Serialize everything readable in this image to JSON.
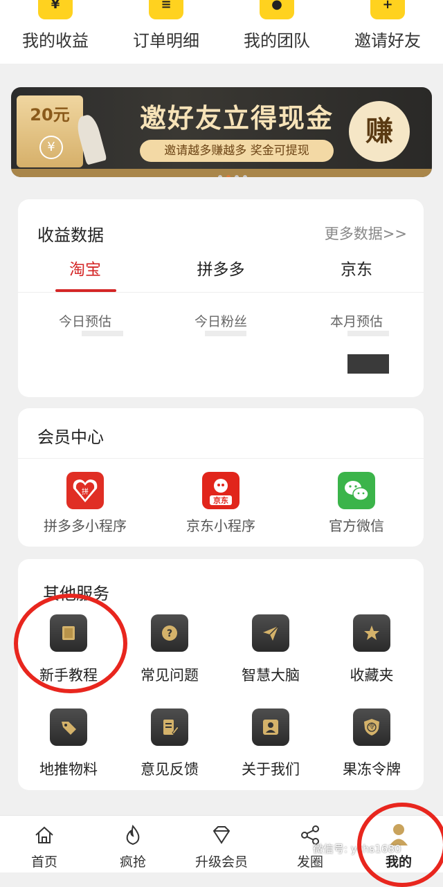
{
  "top_menu": {
    "items": [
      {
        "label": "我的收益",
        "icon": "wallet-yen-icon",
        "glyph": "¥"
      },
      {
        "label": "订单明细",
        "icon": "order-list-icon",
        "glyph": "≡"
      },
      {
        "label": "我的团队",
        "icon": "team-icon",
        "glyph": "●"
      },
      {
        "label": "邀请好友",
        "icon": "invite-icon",
        "glyph": "+"
      }
    ],
    "accent": "#ffd21f"
  },
  "banner": {
    "envelope_amount": "20元",
    "envelope_symbol": "¥",
    "title": "邀好友立得现金",
    "subtitle": "邀请越多赚越多 奖金可提现",
    "badge": "赚",
    "dots_count": 4,
    "active_dot": 1
  },
  "earnings": {
    "title": "收益数据",
    "more_link": "更多数据>>",
    "tabs": [
      {
        "label": "淘宝",
        "active": true
      },
      {
        "label": "拼多多",
        "active": false
      },
      {
        "label": "京东",
        "active": false
      }
    ],
    "metrics": [
      {
        "label": "今日预估"
      },
      {
        "label": "今日粉丝"
      },
      {
        "label": "本月预估"
      }
    ],
    "accent": "#d42626"
  },
  "member_center": {
    "title": "会员中心",
    "items": [
      {
        "label": "拼多多小程序",
        "icon": "pinduoduo-icon",
        "color": "#e02e24"
      },
      {
        "label": "京东小程序",
        "icon": "jd-icon",
        "color": "#e1251b",
        "icon_text": "京东"
      },
      {
        "label": "官方微信",
        "icon": "wechat-icon",
        "color": "#3bb44a"
      }
    ]
  },
  "other_services": {
    "title": "其他服务",
    "items": [
      {
        "label": "新手教程",
        "icon": "book-icon"
      },
      {
        "label": "常见问题",
        "icon": "question-icon"
      },
      {
        "label": "智慧大脑",
        "icon": "paper-plane-icon"
      },
      {
        "label": "收藏夹",
        "icon": "star-icon"
      },
      {
        "label": "地推物料",
        "icon": "tag-icon"
      },
      {
        "label": "意见反馈",
        "icon": "feedback-icon"
      },
      {
        "label": "关于我们",
        "icon": "person-icon"
      },
      {
        "label": "果冻令牌",
        "icon": "shield-token-icon",
        "icon_text": "令"
      }
    ]
  },
  "bottom_nav": {
    "items": [
      {
        "label": "首页",
        "icon": "home-icon"
      },
      {
        "label": "疯抢",
        "icon": "flame-icon"
      },
      {
        "label": "升级会员",
        "icon": "diamond-icon"
      },
      {
        "label": "发圈",
        "icon": "share-icon"
      },
      {
        "label": "我的",
        "icon": "profile-avatar-icon",
        "active": true
      }
    ]
  },
  "watermark": "微信号: ychs1680",
  "annotation_color": "#e8261e"
}
